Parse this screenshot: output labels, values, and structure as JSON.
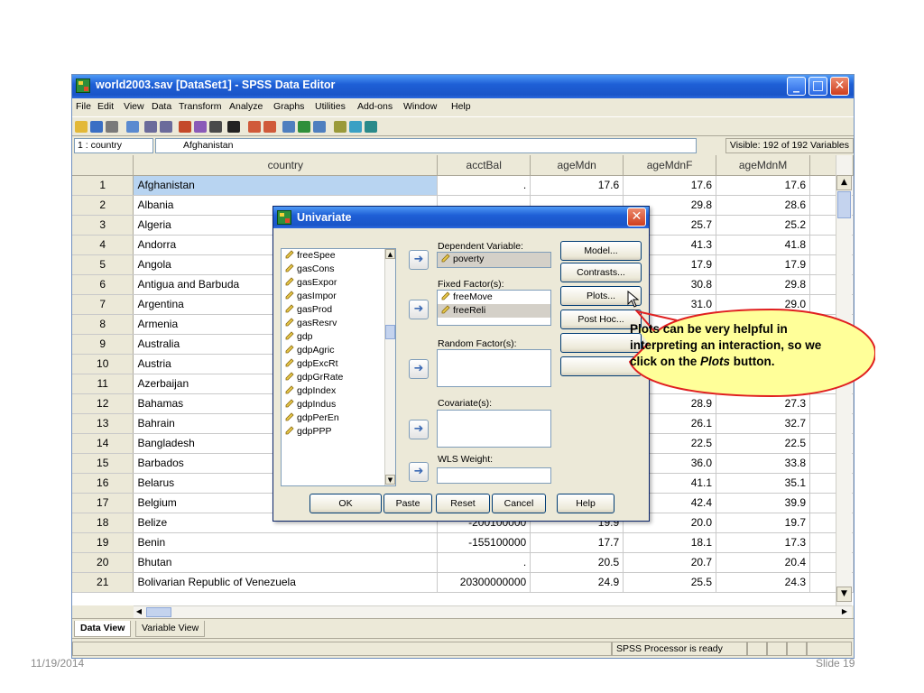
{
  "window": {
    "title": "world2003.sav [DataSet1] - SPSS Data Editor"
  },
  "menu": [
    "File",
    "Edit",
    "View",
    "Data",
    "Transform",
    "Analyze",
    "Graphs",
    "Utilities",
    "Add-ons",
    "Window",
    "Help"
  ],
  "cellbar": {
    "cell_ref": "1 : country",
    "cell_value": "Afghanistan",
    "visible": "Visible: 192 of 192 Variables"
  },
  "columns": [
    "country",
    "acctBal",
    "ageMdn",
    "ageMdnF",
    "ageMdnM"
  ],
  "rows": [
    {
      "n": "1",
      "country": "Afghanistan",
      "acctBal": ".",
      "ageMdn": "17.6",
      "ageMdnF": "17.6",
      "ageMdnM": "17.6"
    },
    {
      "n": "2",
      "country": "Albania",
      "acctBal": "",
      "ageMdn": "",
      "ageMdnF": "29.8",
      "ageMdnM": "28.6"
    },
    {
      "n": "3",
      "country": "Algeria",
      "acctBal": "",
      "ageMdn": "",
      "ageMdnF": "25.7",
      "ageMdnM": "25.2"
    },
    {
      "n": "4",
      "country": "Andorra",
      "acctBal": "",
      "ageMdn": "",
      "ageMdnF": "41.3",
      "ageMdnM": "41.8"
    },
    {
      "n": "5",
      "country": "Angola",
      "acctBal": "",
      "ageMdn": "",
      "ageMdnF": "17.9",
      "ageMdnM": "17.9"
    },
    {
      "n": "6",
      "country": "Antigua and Barbuda",
      "acctBal": "",
      "ageMdn": "",
      "ageMdnF": "30.8",
      "ageMdnM": "29.8"
    },
    {
      "n": "7",
      "country": "Argentina",
      "acctBal": "",
      "ageMdn": "",
      "ageMdnF": "31.0",
      "ageMdnM": "29.0"
    },
    {
      "n": "8",
      "country": "Armenia",
      "acctBal": "",
      "ageMdn": "",
      "ageMdnF": "",
      "ageMdnM": ""
    },
    {
      "n": "9",
      "country": "Australia",
      "acctBal": "",
      "ageMdn": "",
      "ageMdnF": "",
      "ageMdnM": ""
    },
    {
      "n": "10",
      "country": "Austria",
      "acctBal": "",
      "ageMdn": "",
      "ageMdnF": "",
      "ageMdnM": ""
    },
    {
      "n": "11",
      "country": "Azerbaijan",
      "acctBal": "",
      "ageMdn": "",
      "ageMdnF": "",
      "ageMdnM": ""
    },
    {
      "n": "12",
      "country": "Bahamas",
      "acctBal": "",
      "ageMdn": "",
      "ageMdnF": "28.9",
      "ageMdnM": "27.3"
    },
    {
      "n": "13",
      "country": "Bahrain",
      "acctBal": "",
      "ageMdn": "",
      "ageMdnF": "26.1",
      "ageMdnM": "32.7"
    },
    {
      "n": "14",
      "country": "Bangladesh",
      "acctBal": "",
      "ageMdn": "",
      "ageMdnF": "22.5",
      "ageMdnM": "22.5"
    },
    {
      "n": "15",
      "country": "Barbados",
      "acctBal": "",
      "ageMdn": "",
      "ageMdnF": "36.0",
      "ageMdnM": "33.8"
    },
    {
      "n": "16",
      "country": "Belarus",
      "acctBal": "",
      "ageMdn": "",
      "ageMdnF": "41.1",
      "ageMdnM": "35.1"
    },
    {
      "n": "17",
      "country": "Belgium",
      "acctBal": "",
      "ageMdn": "",
      "ageMdnF": "42.4",
      "ageMdnM": "39.9"
    },
    {
      "n": "18",
      "country": "Belize",
      "acctBal": "-200100000",
      "ageMdn": "19.9",
      "ageMdnF": "20.0",
      "ageMdnM": "19.7"
    },
    {
      "n": "19",
      "country": "Benin",
      "acctBal": "-155100000",
      "ageMdn": "17.7",
      "ageMdnF": "18.1",
      "ageMdnM": "17.3"
    },
    {
      "n": "20",
      "country": "Bhutan",
      "acctBal": ".",
      "ageMdn": "20.5",
      "ageMdnF": "20.7",
      "ageMdnM": "20.4"
    },
    {
      "n": "21",
      "country": "Bolivarian Republic of Venezuela",
      "acctBal": "20300000000",
      "ageMdn": "24.9",
      "ageMdnF": "25.5",
      "ageMdnM": "24.3"
    }
  ],
  "tabs": {
    "data_view": "Data View",
    "variable_view": "Variable View"
  },
  "status": "SPSS  Processor is ready",
  "dialog": {
    "title": "Univariate",
    "variables": [
      "freeSpee",
      "gasCons",
      "gasExpor",
      "gasImpor",
      "gasProd",
      "gasResrv",
      "gdp",
      "gdpAgric",
      "gdpExcRt",
      "gdpGrRate",
      "gdpIndex",
      "gdpIndus",
      "gdpPerEn",
      "gdpPPP"
    ],
    "dependent_label": "Dependent Variable:",
    "dependent_value": "poverty",
    "fixed_label": "Fixed Factor(s):",
    "fixed_values": [
      "freeMove",
      "freeReli"
    ],
    "random_label": "Random Factor(s):",
    "covariate_label": "Covariate(s):",
    "wls_label": "WLS Weight:",
    "side_buttons": [
      "Model...",
      "Contrasts...",
      "Plots...",
      "Post Hoc..."
    ],
    "bottom_buttons": [
      "OK",
      "Paste",
      "Reset",
      "Cancel",
      "Help"
    ]
  },
  "callout": {
    "text_before": "Plots can be very helpful in interpreting an interaction, so we click on the ",
    "text_em": "Plots",
    "text_after": " button."
  },
  "slide": {
    "date": "11/19/2014",
    "number": "Slide 19"
  },
  "colors": {
    "titlebar": "#1e5fd6",
    "selection": "#b8d4f1",
    "callout_fill": "#ffff99",
    "callout_border": "#e02020"
  }
}
